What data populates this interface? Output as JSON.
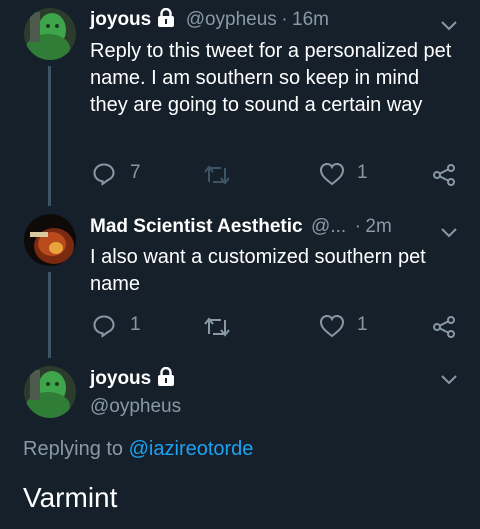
{
  "tweets": [
    {
      "name": "joyous",
      "handle": "@oypheus",
      "time": "16m",
      "dot": "·",
      "text": "Reply to this tweet for a personalized pet name. I am southern so keep in mind they are going to sound a certain way",
      "reply_count": "7",
      "like_count": "1"
    },
    {
      "name": "Mad Scientist Aesthetic",
      "handle": "@...",
      "time": "2m",
      "dot": "·",
      "text": "I also want a customized southern pet name",
      "reply_count": "1",
      "like_count": "1"
    }
  ],
  "main_tweet": {
    "name": "joyous",
    "handle": "@oypheus",
    "replying_prefix": "Replying to",
    "replying_handle": "@iazireotorde",
    "text": "Varmint"
  },
  "colors": {
    "background": "#15202b",
    "secondary_text": "#8899a6",
    "link": "#1da1f2",
    "thread_line": "#3d5466"
  },
  "icons": [
    "lock-icon",
    "chevron-down-icon",
    "reply-icon",
    "retweet-icon",
    "like-icon",
    "share-icon"
  ]
}
